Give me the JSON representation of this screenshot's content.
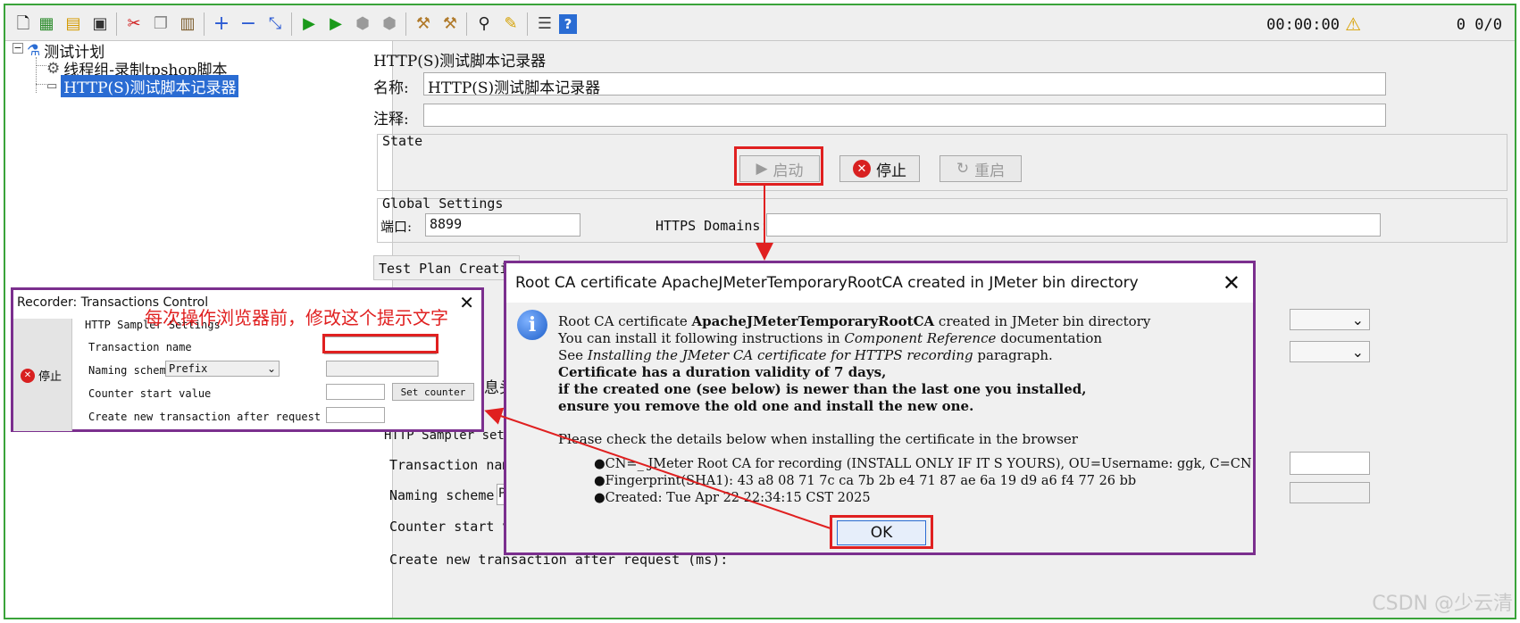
{
  "toolbar": {
    "icons": [
      "new-icon",
      "templates-icon",
      "open-icon",
      "save-icon",
      "cut-icon",
      "copy-icon",
      "paste-icon",
      "expand-icon",
      "collapse-icon",
      "toggle-icon",
      "start-icon",
      "start-no-pause-icon",
      "stop-icon",
      "shutdown-icon",
      "clear-icon",
      "clear-all-icon",
      "search-icon",
      "reset-search-icon",
      "function-helper-icon",
      "help-icon"
    ],
    "timer": "00:00:00",
    "warning_count": "0",
    "thread_counts": "0/0"
  },
  "tree": {
    "root": "测试计划",
    "thread_group": "线程组-录制tpshop脚本",
    "recorder": "HTTP(S)测试脚本记录器"
  },
  "main": {
    "header": "HTTP(S)测试脚本记录器",
    "name_label": "名称:",
    "name_value": "HTTP(S)测试脚本记录器",
    "comment_label": "注释:",
    "comment_value": "",
    "state_label": "State",
    "start_label": "启动",
    "stop_label": "停止",
    "restart_label": "重启",
    "global_label": "Global Settings",
    "port_label": "端口:",
    "port_value": "8899",
    "https_label": "HTTPS Domains:",
    "https_value": "",
    "test_plan_label": "Test Plan Creatio",
    "partial_text": "息头",
    "sampler_label": "HTTP Sampler set",
    "transaction_label": "Transaction nam",
    "naming_label": "Naming scheme",
    "naming_partial": "P",
    "counter_label": "Counter start v",
    "create_label": "Create new transaction after request (ms):"
  },
  "recorder_window": {
    "title": "Recorder: Transactions Control",
    "stop_label": "停止",
    "sampler_settings": "HTTP Sampler Settings",
    "transaction_name_label": "Transaction name",
    "naming_scheme_label": "Naming scheme",
    "naming_scheme_value": "Prefix",
    "counter_label": "Counter start value",
    "set_counter_label": "Set counter",
    "create_after_label": "Create new transaction after request (ms):"
  },
  "annotation": "每次操作浏览器前，修改这个提示文字",
  "dialog": {
    "title": "Root CA certificate ApacheJMeterTemporaryRootCA created in JMeter bin directory",
    "line1_pre": "Root CA certificate ",
    "line1_bold": "ApacheJMeterTemporaryRootCA",
    "line1_post": " created in JMeter bin directory",
    "line2_pre": "You can install it following instructions in ",
    "line2_italic": "Component Reference",
    "line2_post": " documentation",
    "line3_pre": "See ",
    "line3_italic": "Installing the JMeter CA certificate for HTTPS recording",
    "line3_post": " paragraph.",
    "bold1": "Certificate has a duration validity of 7 days,",
    "bold2": "if the created one (see below) is newer than the last one you installed,",
    "bold3": "ensure you remove the old one and install the new one.",
    "check_line": "Please check the details below when installing the certificate in the browser",
    "bullet1": "●CN=_ JMeter Root CA for recording (INSTALL ONLY IF IT S YOURS), OU=Username: ggk, C=CN",
    "bullet2": "●Fingerprint(SHA1): 43 a8 08 71 7c ca 7b 2b e4 71 87 ae 6a 19 d9 a6 f4 77 26 bb",
    "bullet3": "●Created: Tue Apr 22 22:34:15 CST 2025",
    "ok_label": "OK"
  },
  "watermark": "CSDN @少云清",
  "colors": {
    "highlight_red": "#e02020",
    "frame_purple": "#7b2f8e",
    "frame_green": "#3aa33a",
    "selection_blue": "#2a6cd3"
  }
}
